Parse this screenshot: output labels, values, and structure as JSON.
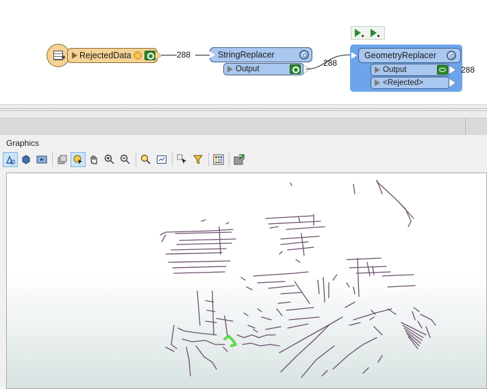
{
  "workflow": {
    "nodes": {
      "reader": {
        "name": "RejectedData",
        "icon": "table-icon"
      },
      "string_replacer": {
        "name": "StringReplacer",
        "port": "Output"
      },
      "geometry_replacer": {
        "name": "GeometryReplacer",
        "ports": [
          "Output",
          "<Rejected>"
        ]
      }
    },
    "feature_counts": {
      "reader_to_string": "288",
      "string_to_geometry": "288",
      "geometry_output": "288"
    }
  },
  "panel": {
    "title": "Graphics",
    "toolbar": [
      "select-shape-icon",
      "3d-view-icon",
      "playback-icon",
      "layers-icon",
      "select-info-icon",
      "pan-hand-icon",
      "zoom-in-icon",
      "zoom-out-icon",
      "inspect-zoom-icon",
      "zoom-extents-icon",
      "select-pointer-icon",
      "filter-icon",
      "background-color-icon",
      "export-icon"
    ]
  },
  "colors": {
    "reader_fill": "#f6d296",
    "transformer_fill": "#a9c7ef",
    "selected_fill": "#6ea4ea",
    "geometry_stroke": "#6a4e6c",
    "highlight_green": "#48d23a"
  }
}
